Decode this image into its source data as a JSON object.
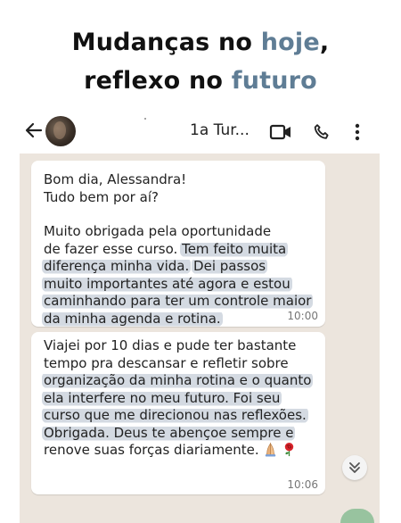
{
  "headline": {
    "line1_prefix": "Mudanças no ",
    "line1_highlight": "hoje",
    "line1_suffix": ",",
    "line2_prefix": "reflexo no ",
    "line2_highlight": "futuro",
    "highlight_color": "#5f7d95"
  },
  "chat_header": {
    "contact_name": "1a Tur...",
    "icons": [
      "back-arrow-icon",
      "avatar",
      "video-call-icon",
      "voice-call-icon",
      "more-options-icon"
    ]
  },
  "messages": [
    {
      "lines": [
        "Bom dia, Alessandra!",
        "Tudo bem por aí?",
        "Muito obrigada pela oportunidade",
        "de fazer esse curso.",
        "Tem feito muita",
        "diferença minha vida.",
        "Dei passos",
        "muito importantes até agora e estou",
        "caminhando para ter um controle maior",
        "da minha agenda e rotina."
      ],
      "time": "10:00"
    },
    {
      "lines": [
        "Viajei por 10 dias e pude ter bastante",
        "tempo pra descansar e refletir sobre",
        "organização da minha rotina e o quanto",
        "ela interfere no meu futuro. Foi seu",
        "curso que me direcionou nas reflexões.",
        "Obrigada. Deus te abençoe sempre e",
        "renove suas forças diariamente."
      ],
      "emojis": [
        "praying-hands-icon",
        "rose-icon"
      ],
      "time": "10:06"
    }
  ],
  "colors": {
    "chat_background": "#ece5dd",
    "bubble": "#ffffff",
    "highlight_marker": "#788ca5"
  }
}
